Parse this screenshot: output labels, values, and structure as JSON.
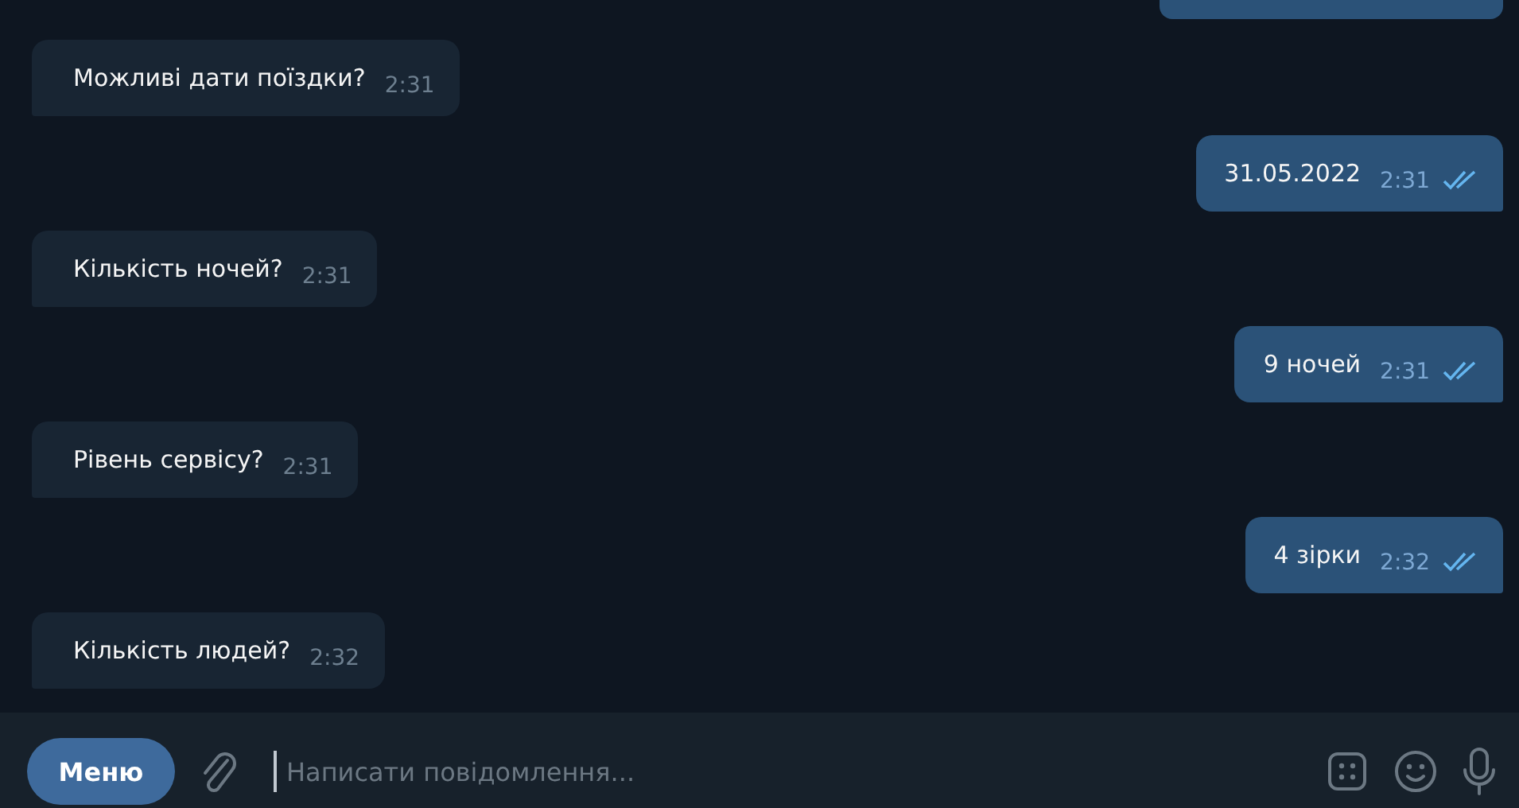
{
  "messages": [
    {
      "kind": "incoming",
      "text": "Можливі дати поїздки?",
      "time": "2:31"
    },
    {
      "kind": "outgoing",
      "text": "31.05.2022",
      "time": "2:31",
      "read": true
    },
    {
      "kind": "incoming",
      "text": "Кількість ночей?",
      "time": "2:31"
    },
    {
      "kind": "outgoing",
      "text": "9 ночей",
      "time": "2:31",
      "read": true
    },
    {
      "kind": "incoming",
      "text": "Рівень сервісу?",
      "time": "2:31"
    },
    {
      "kind": "outgoing",
      "text": "4 зірки",
      "time": "2:32",
      "read": true
    },
    {
      "kind": "incoming",
      "text": "Кількість людей?",
      "time": "2:32"
    }
  ],
  "composer": {
    "menu_button": "Меню",
    "placeholder": "Написати повідомлення..."
  }
}
